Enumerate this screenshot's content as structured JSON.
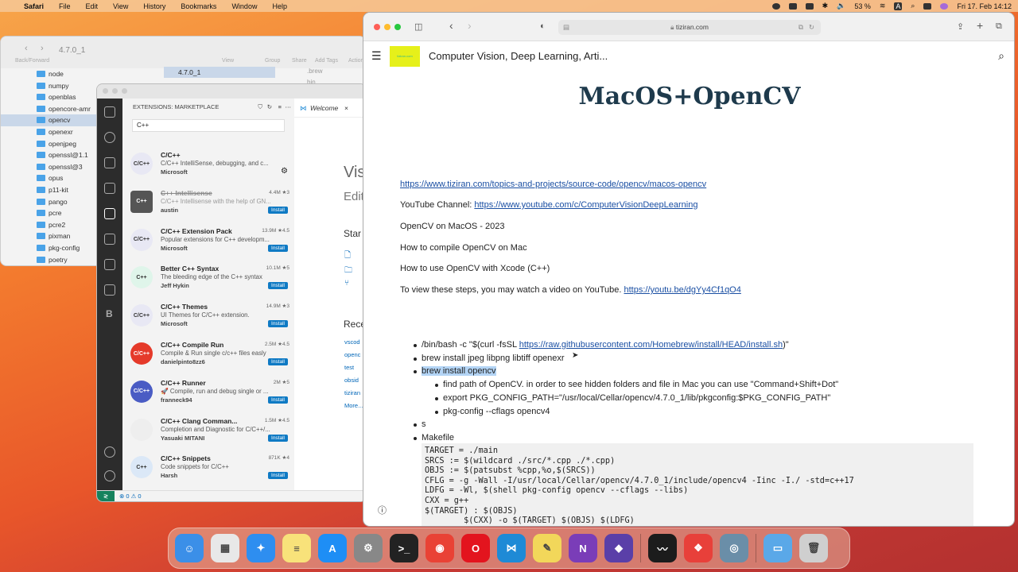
{
  "menubar": {
    "items": [
      "Safari",
      "File",
      "Edit",
      "View",
      "History",
      "Bookmarks",
      "Window",
      "Help"
    ],
    "battery": "53 %",
    "ime": "A",
    "datetime": "Fri 17. Feb 14:12"
  },
  "finder": {
    "title": "4.7.0_1",
    "back_label": "Back/Forward",
    "toolbar": [
      "View",
      "Group",
      "Share",
      "Add Tags",
      "Action"
    ],
    "items": [
      "node",
      "numpy",
      "openblas",
      "opencore-amr",
      "opencv",
      "openexr",
      "openjpeg",
      "openssl@1.1",
      "openssl@3",
      "opus",
      "p11-kit",
      "pango",
      "pcre",
      "pcre2",
      "pixman",
      "pkg-config",
      "poetry"
    ],
    "selected": "4.7.0_1",
    "col3": [
      ".brew",
      "bin"
    ]
  },
  "vscode": {
    "sidebar_title": "EXTENSIONS: MARKETPLACE",
    "search": "C++",
    "tab": "Welcome",
    "status_counts": "⊗ 0 ⚠ 0",
    "editor": {
      "big": "Vis",
      "sub": "Edit",
      "start": "Star",
      "recent": "Rece",
      "links": [
        "vscod",
        "openc",
        "test",
        "obsid",
        "tiziran",
        "More..."
      ]
    },
    "extensions": [
      {
        "name": "C/C++",
        "desc": "C/C++ IntelliSense, debugging, and c...",
        "pub": "Microsoft",
        "stats": "",
        "install": "",
        "logo": "C/C++",
        "color": "#e8e8f4"
      },
      {
        "name": "C++ Intellisense",
        "desc": "C/C++ Intellisense with the help of GN...",
        "pub": "austin",
        "stats": "4.4M ★3",
        "install": "Install",
        "logo": "C++",
        "color": "#555",
        "dep": true
      },
      {
        "name": "C/C++ Extension Pack",
        "desc": "Popular extensions for C++ developm...",
        "pub": "Microsoft",
        "stats": "13.9M ★4.5",
        "install": "Install",
        "logo": "C/C++",
        "color": "#e8e8f4"
      },
      {
        "name": "Better C++ Syntax",
        "desc": "The bleeding edge of the C++ syntax",
        "pub": "Jeff Hykin",
        "stats": "10.1M ★5",
        "install": "Install",
        "logo": "C++",
        "color": "#dff5ea"
      },
      {
        "name": "C/C++ Themes",
        "desc": "UI Themes for C/C++ extension.",
        "pub": "Microsoft",
        "stats": "14.9M ★3",
        "install": "Install",
        "logo": "C/C++",
        "color": "#e8e8f4"
      },
      {
        "name": "C/C++ Compile Run",
        "desc": "Compile & Run single c/c++ files easly",
        "pub": "danielpinto8zz6",
        "stats": "2.5M ★4.5",
        "install": "Install",
        "logo": "C/C++",
        "color": "#e53a2a"
      },
      {
        "name": "C/C++ Runner",
        "desc": "🚀 Compile, run and debug single or ...",
        "pub": "franneck94",
        "stats": "2M ★5",
        "install": "Install",
        "logo": "C/C++",
        "color": "#4a5cc4"
      },
      {
        "name": "C/C++ Clang Comman...",
        "desc": "Completion and Diagnostic for C/C++/...",
        "pub": "Yasuaki MITANI",
        "stats": "1.5M ★4.5",
        "install": "Install",
        "logo": "",
        "color": "#eee"
      },
      {
        "name": "C/C++ Snippets",
        "desc": "Code snippets for C/C++",
        "pub": "Harsh",
        "stats": "871K ★4",
        "install": "Install",
        "logo": "C++",
        "color": "#dbe8f7"
      }
    ]
  },
  "safari": {
    "url": "tiziran.com",
    "site_title": "Computer Vision, Deep Learning, Arti...",
    "heading": "MacOS+OpenCV",
    "link1": "https://www.tiziran.com/topics-and-projects/source-code/opencv/macos-opencv",
    "yt_prefix": "YouTube Channel: ",
    "yt_link": "https://www.youtube.com/c/ComputerVisionDeepLearning",
    "p1": "OpenCV on MacOS - 2023",
    "p2": "How to compile OpenCV on Mac",
    "p3": "How to use OpenCV with Xcode (C++)",
    "p4_prefix": "To view these steps, you may watch a video on YouTube.  ",
    "p4_link": "https://youtu.be/dgYy4Cf1qO4",
    "b1_prefix": "/bin/bash -c \"$(curl -fsSL ",
    "b1_link": "https://raw.githubusercontent.com/Homebrew/install/HEAD/install.sh",
    "b1_suffix": ")\"",
    "b2": "brew install jpeg libpng libtiff openexr",
    "b3": "brew install opencv",
    "sub1": "find path of OpenCV. in order to see hidden folders and file in Mac you can use \"Command+Shift+Dot\"",
    "sub2": "export PKG_CONFIG_PATH=\"/usr/local/Cellar/opencv/4.7.0_1/lib/pkgconfig:$PKG_CONFIG_PATH\"",
    "sub3": "pkg-config --cflags opencv4",
    "b4": "s",
    "b5": "Makefile",
    "code": "TARGET = ./main\nSRCS := $(wildcard ./src/*.cpp ./*.cpp)\nOBJS := $(patsubst %cpp,%o,$(SRCS))\nCFLG = -g -Wall -I/usr/local/Cellar/opencv/4.7.0_1/include/opencv4 -Iinc -I./ -std=c++17\nLDFG = -Wl, $(shell pkg-config opencv --cflags --libs)\nCXX = g++\n$(TARGET) : $(OBJS)\n        $(CXX) -o $(TARGET) $(OBJS) $(LDFG)"
  },
  "dock": {
    "apps": [
      {
        "name": "Finder",
        "color": "#3b8fe8",
        "glyph": "☺"
      },
      {
        "name": "Launchpad",
        "color": "#e8e8e8",
        "glyph": "▦"
      },
      {
        "name": "Safari",
        "color": "#2e8ef0",
        "glyph": "✦"
      },
      {
        "name": "Notes",
        "color": "#f8e27a",
        "glyph": "≡"
      },
      {
        "name": "App Store",
        "color": "#1e8ef5",
        "glyph": "A"
      },
      {
        "name": "System Settings",
        "color": "#888",
        "glyph": "⚙"
      },
      {
        "name": "Terminal",
        "color": "#222",
        "glyph": ">_"
      },
      {
        "name": "Chrome",
        "color": "#e94235",
        "glyph": "◉"
      },
      {
        "name": "Opera",
        "color": "#e3141e",
        "glyph": "O"
      },
      {
        "name": "VS Code",
        "color": "#1e8ad6",
        "glyph": "⋈"
      },
      {
        "name": "Stickies",
        "color": "#f2d75a",
        "glyph": "✎"
      },
      {
        "name": "OneNote",
        "color": "#7a3db8",
        "glyph": "N"
      },
      {
        "name": "Obsidian",
        "color": "#5a3fa8",
        "glyph": "◆"
      },
      {
        "name": "Activity Monitor",
        "color": "#1c1c1c",
        "glyph": "〰"
      },
      {
        "name": "AnyDesk",
        "color": "#e8403a",
        "glyph": "❖"
      },
      {
        "name": "Proxyman",
        "color": "#6a8ea8",
        "glyph": "◎"
      },
      {
        "name": "Downloads",
        "color": "#5aa8e8",
        "glyph": "▭"
      },
      {
        "name": "Trash",
        "color": "#cfcfcf",
        "glyph": "🗑"
      }
    ]
  }
}
